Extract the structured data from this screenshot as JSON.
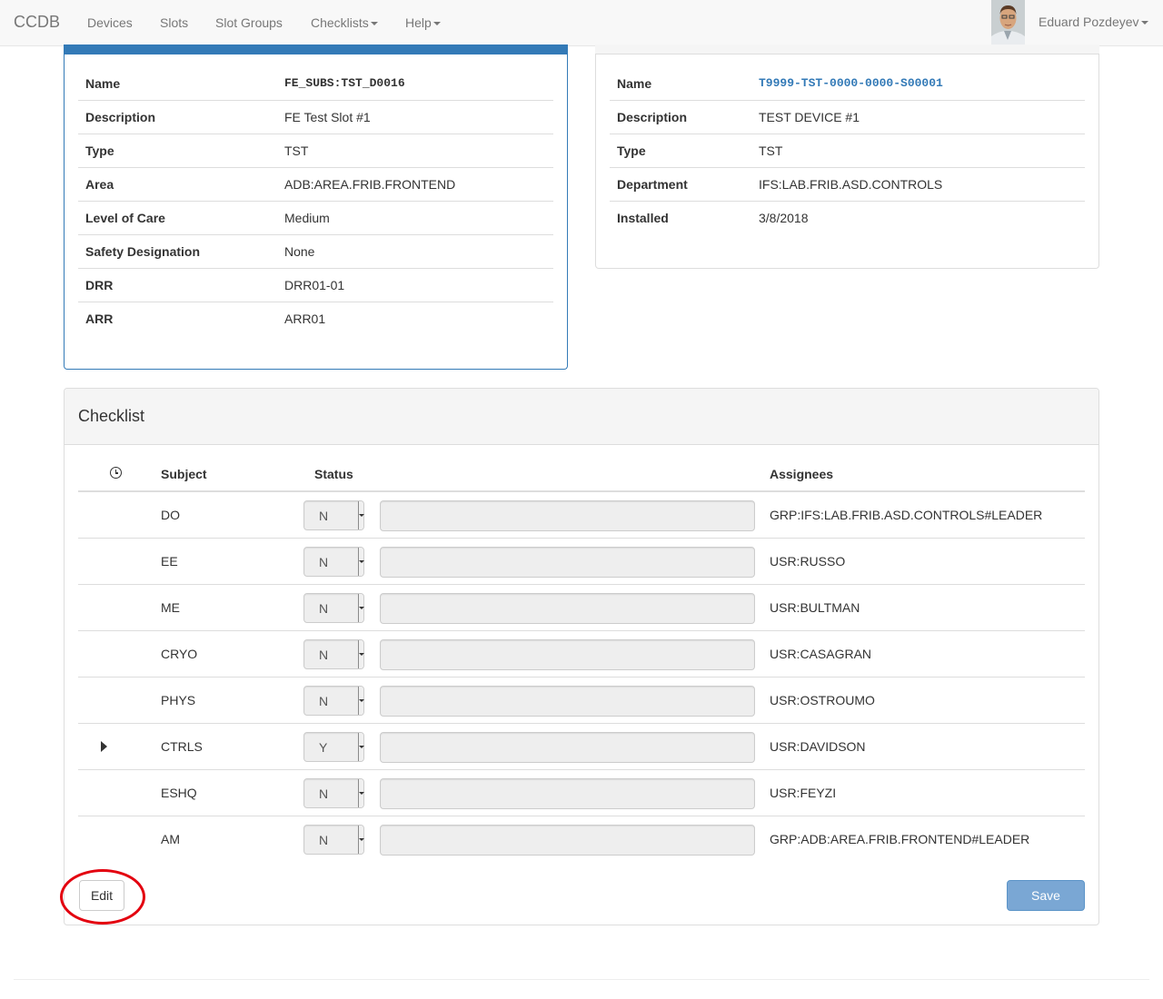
{
  "navbar": {
    "brand": "CCDB",
    "items": [
      {
        "label": "Devices",
        "dropdown": false
      },
      {
        "label": "Slots",
        "dropdown": false
      },
      {
        "label": "Slot Groups",
        "dropdown": false
      },
      {
        "label": "Checklists",
        "dropdown": true
      },
      {
        "label": "Help",
        "dropdown": true
      }
    ],
    "user": "Eduard Pozdeyev"
  },
  "slot_panel": {
    "rows": [
      {
        "key": "Name",
        "value": "FE_SUBS:TST_D0016"
      },
      {
        "key": "Description",
        "value": "FE Test Slot #1"
      },
      {
        "key": "Type",
        "value": "TST"
      },
      {
        "key": "Area",
        "value": "ADB:AREA.FRIB.FRONTEND"
      },
      {
        "key": "Level of Care",
        "value": "Medium"
      },
      {
        "key": "Safety Designation",
        "value": "None"
      },
      {
        "key": "DRR",
        "value": "DRR01-01"
      },
      {
        "key": "ARR",
        "value": "ARR01"
      }
    ]
  },
  "device_panel": {
    "rows": [
      {
        "key": "Name",
        "value": "T9999-TST-0000-0000-S00001"
      },
      {
        "key": "Description",
        "value": "TEST DEVICE #1"
      },
      {
        "key": "Type",
        "value": "TST"
      },
      {
        "key": "Department",
        "value": "IFS:LAB.FRIB.ASD.CONTROLS"
      },
      {
        "key": "Installed",
        "value": "3/8/2018"
      }
    ]
  },
  "checklist": {
    "title": "Checklist",
    "columns": {
      "subject": "Subject",
      "status": "Status",
      "assignees": "Assignees"
    },
    "rows": [
      {
        "subject": "DO",
        "status": "N",
        "comment": "",
        "assignee": "GRP:IFS:LAB.FRIB.ASD.CONTROLS#LEADER",
        "expandable": false
      },
      {
        "subject": "EE",
        "status": "N",
        "comment": "",
        "assignee": "USR:RUSSO",
        "expandable": false
      },
      {
        "subject": "ME",
        "status": "N",
        "comment": "",
        "assignee": "USR:BULTMAN",
        "expandable": false
      },
      {
        "subject": "CRYO",
        "status": "N",
        "comment": "",
        "assignee": "USR:CASAGRAN",
        "expandable": false
      },
      {
        "subject": "PHYS",
        "status": "N",
        "comment": "",
        "assignee": "USR:OSTROUMO",
        "expandable": false
      },
      {
        "subject": "CTRLS",
        "status": "Y",
        "comment": "",
        "assignee": "USR:DAVIDSON",
        "expandable": true
      },
      {
        "subject": "ESHQ",
        "status": "N",
        "comment": "",
        "assignee": "USR:FEYZI",
        "expandable": false
      },
      {
        "subject": "AM",
        "status": "N",
        "comment": "",
        "assignee": "GRP:ADB:AREA.FRIB.FRONTEND#LEADER",
        "expandable": false
      }
    ],
    "edit_label": "Edit",
    "save_label": "Save"
  },
  "colors": {
    "primary": "#337ab7",
    "highlight": "#e3000f"
  }
}
